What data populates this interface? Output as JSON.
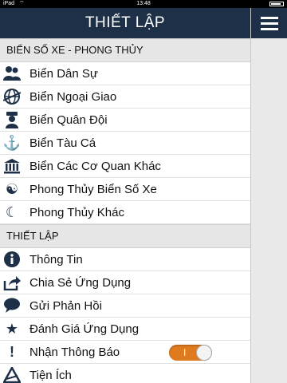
{
  "statusbar": {
    "carrier": "iPad",
    "time": "13:48"
  },
  "nav": {
    "title": "THIẾT LẬP"
  },
  "sections": [
    {
      "title": "BIỂN SỐ XE - PHONG THỦY",
      "items": [
        {
          "label": "Biển Dân Sự",
          "icon": "people-icon"
        },
        {
          "label": "Biển Ngoại Giao",
          "icon": "globe-icon"
        },
        {
          "label": "Biển Quân Đội",
          "icon": "soldier-icon"
        },
        {
          "label": "Biển Tàu Cá",
          "icon": "anchor-icon"
        },
        {
          "label": "Biển Các Cơ Quan Khác",
          "icon": "building-icon"
        },
        {
          "label": "Phong Thủy Biển Số Xe",
          "icon": "yin-yang-icon"
        },
        {
          "label": "Phong Thủy Khác",
          "icon": "moon-icon"
        }
      ]
    },
    {
      "title": "THIẾT LẬP",
      "items": [
        {
          "label": "Thông Tin",
          "icon": "info-icon"
        },
        {
          "label": "Chia Sẻ Ứng Dụng",
          "icon": "share-icon"
        },
        {
          "label": "Gửi Phản Hồi",
          "icon": "speech-bubble-icon"
        },
        {
          "label": "Đánh Giá Ứng Dụng",
          "icon": "star-icon"
        },
        {
          "label": "Nhận Thông Báo",
          "icon": "exclamation-icon",
          "toggle_label": "I",
          "toggle_on": true
        },
        {
          "label": "Tiện Ích",
          "icon": "tools-icon"
        }
      ]
    }
  ],
  "colors": {
    "navbar": "#1e3047",
    "toggle_on": "#e07a1f",
    "icon": "#1e3047"
  }
}
